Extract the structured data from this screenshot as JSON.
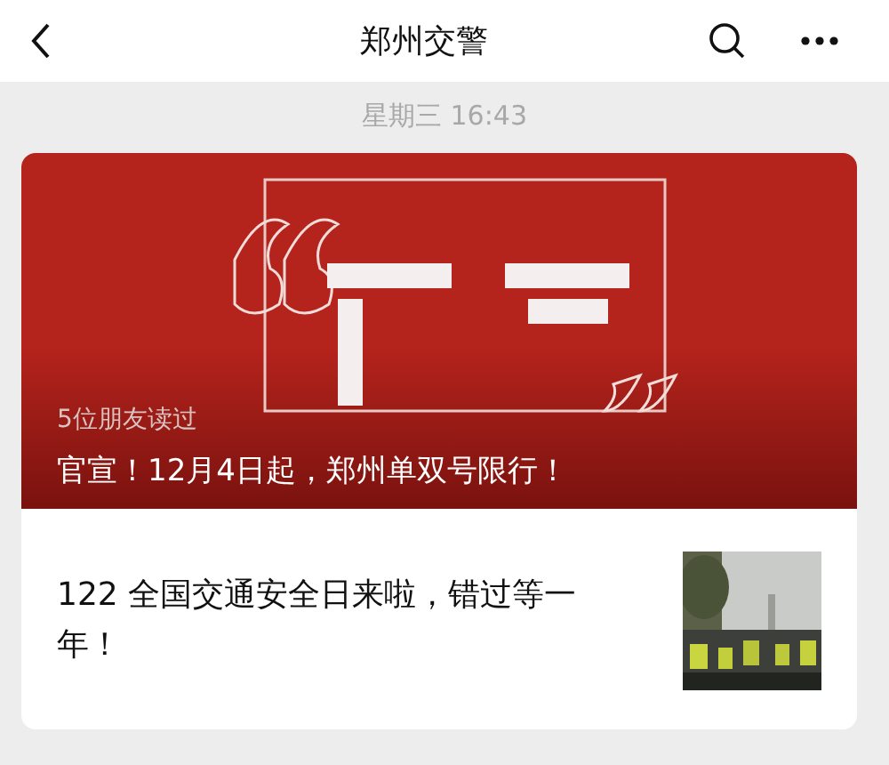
{
  "nav": {
    "title": "郑州交警"
  },
  "timestamp": "星期三 16:43",
  "articles": [
    {
      "kind": "cover",
      "readers": "5位朋友读过",
      "title": "官宣！12月4日起，郑州单双号限行！"
    },
    {
      "kind": "thumb",
      "title": "122 全国交通安全日来啦，错过等一年！"
    }
  ]
}
